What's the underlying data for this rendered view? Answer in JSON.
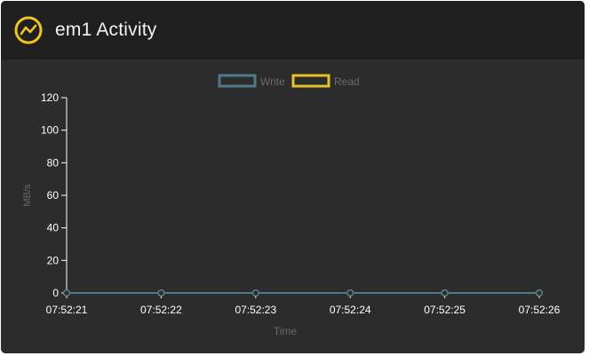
{
  "header": {
    "title": "em1 Activity",
    "icon": "activity-icon",
    "accent_color": "#f0c420"
  },
  "chart_data": {
    "type": "line",
    "xlabel": "Time",
    "ylabel": "MB/s",
    "ylim": [
      0,
      120
    ],
    "yticks": [
      0,
      20,
      40,
      60,
      80,
      100,
      120
    ],
    "categories": [
      "07:52:21",
      "07:52:22",
      "07:52:23",
      "07:52:24",
      "07:52:25",
      "07:52:26"
    ],
    "series": [
      {
        "name": "Write",
        "color": "#4e7a8a",
        "values": [
          0,
          0,
          0,
          0,
          0,
          0
        ]
      },
      {
        "name": "Read",
        "color": "#e6c229",
        "values": [
          0,
          0,
          0,
          0,
          0,
          0
        ]
      }
    ],
    "legend_position": "top-center",
    "grid": false
  }
}
